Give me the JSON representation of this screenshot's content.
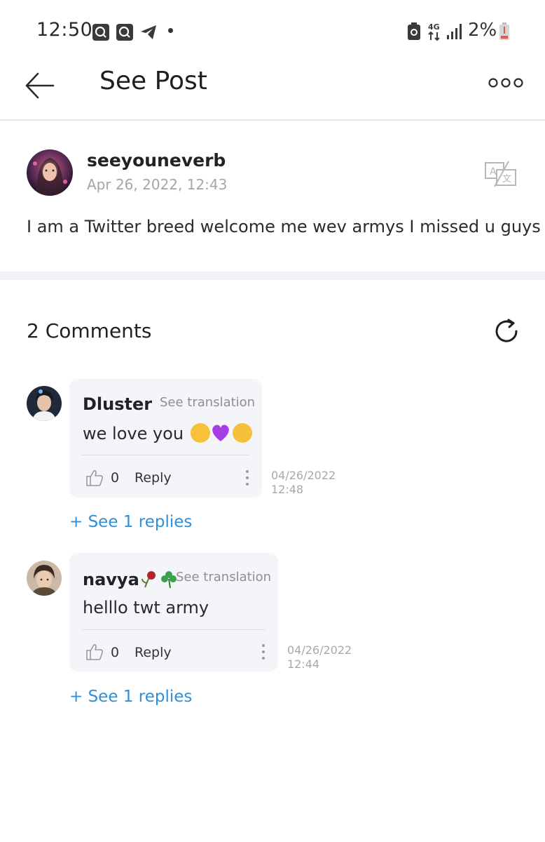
{
  "status_bar": {
    "time": "12:50",
    "network": "4G",
    "battery": "2%"
  },
  "header": {
    "title": "See Post"
  },
  "post": {
    "username": "seeyouneverb",
    "date": "Apr 26, 2022, 12:43",
    "text": "I am a Twitter breed welcome me wev armys I missed u guys"
  },
  "comments_section": {
    "title": "2 Comments",
    "items": [
      {
        "username": "Dluster",
        "see_translation": "See translation",
        "text": "we love you",
        "likes": "0",
        "reply_label": "Reply",
        "date": "04/26/2022",
        "time": "12:48",
        "see_replies": "+ See 1 replies"
      },
      {
        "username": "navya",
        "see_translation": "See translation",
        "text": "helllo twt army",
        "likes": "0",
        "reply_label": "Reply",
        "date": "04/26/2022",
        "time": "12:44",
        "see_replies": "+ See 1 replies"
      }
    ]
  },
  "colors": {
    "accent_link": "#2f8fd6",
    "bubble_bg": "#f4f5f8",
    "muted_text": "#a6a6a6"
  }
}
